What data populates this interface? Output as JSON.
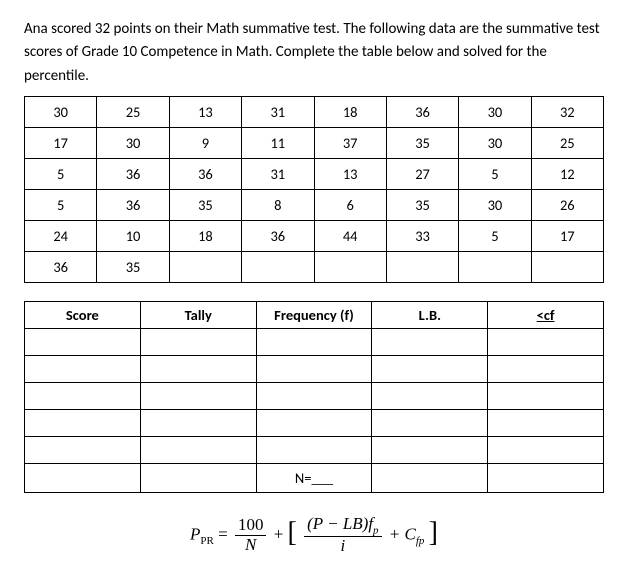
{
  "intro": {
    "line1": "Ana scored 32 points on their Math summative test. The following data are the summative test",
    "line2": "scores of Grade 10 Competence in Math. Complete the table below and solved for the",
    "line3": "percentile."
  },
  "data_rows": [
    [
      "30",
      "25",
      "13",
      "31",
      "18",
      "36",
      "30",
      "32"
    ],
    [
      "17",
      "30",
      "9",
      "11",
      "37",
      "35",
      "30",
      "25"
    ],
    [
      "5",
      "36",
      "36",
      "31",
      "13",
      "27",
      "5",
      "12"
    ],
    [
      "5",
      "36",
      "35",
      "8",
      "6",
      "35",
      "30",
      "26"
    ],
    [
      "24",
      "10",
      "18",
      "36",
      "44",
      "33",
      "5",
      "17"
    ],
    [
      "36",
      "35",
      "",
      "",
      "",
      "",
      "",
      ""
    ]
  ],
  "freq_headers": [
    "Score",
    "Tally",
    "Frequency (f)",
    "L.B.",
    "<cf"
  ],
  "n_label": "N=___",
  "formula": {
    "lhs_P": "P",
    "lhs_sub": "PR",
    "eq": " = ",
    "frac1_num": "100",
    "frac1_den": "N",
    "plus1": " + ",
    "lbr": "[",
    "inner_num_left": "(P − LB)f",
    "inner_num_sub": "p",
    "inner_den": "i",
    "plus2": " + C",
    "cfp_sub": "fp",
    "rbr": "]"
  }
}
